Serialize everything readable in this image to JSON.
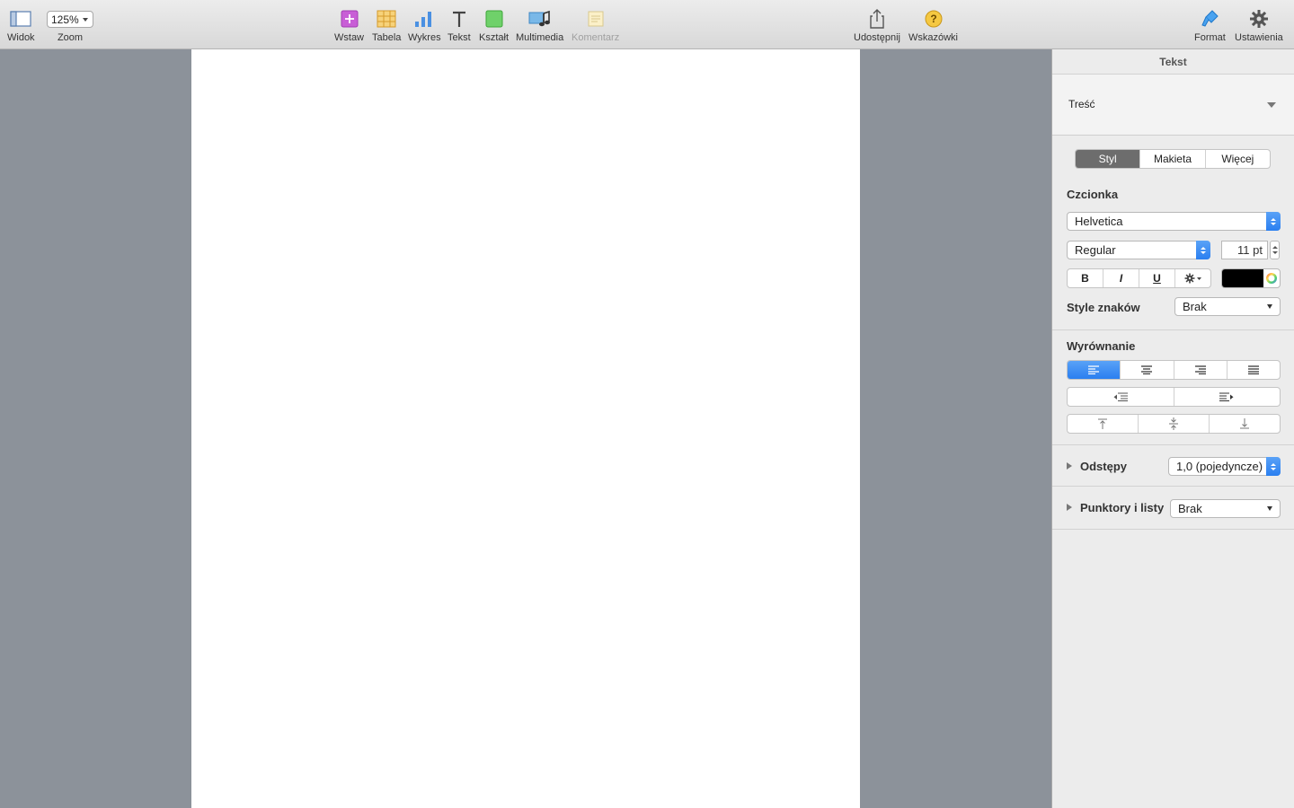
{
  "toolbar": {
    "view_label": "Widok",
    "zoom_value": "125%",
    "zoom_label": "Zoom",
    "insert_label": "Wstaw",
    "table_label": "Tabela",
    "chart_label": "Wykres",
    "text_label": "Tekst",
    "shape_label": "Kształt",
    "media_label": "Multimedia",
    "comment_label": "Komentarz",
    "share_label": "Udostępnij",
    "tips_label": "Wskazówki",
    "format_label": "Format",
    "setup_label": "Ustawienia"
  },
  "inspector": {
    "title": "Tekst",
    "paragraph_style": "Treść",
    "tabs": {
      "style": "Styl",
      "layout": "Makieta",
      "more": "Więcej"
    },
    "font_heading": "Czcionka",
    "font_family": "Helvetica",
    "font_typeface": "Regular",
    "font_size": "11 pt",
    "bold": "B",
    "italic": "I",
    "underline": "U",
    "char_styles_label": "Style znaków",
    "char_styles_value": "Brak",
    "alignment_heading": "Wyrównanie",
    "spacing_label": "Odstępy",
    "spacing_value": "1,0 (pojedyncze)",
    "bullets_label": "Punktory i listy",
    "bullets_value": "Brak"
  },
  "colors": {
    "accent": "#2a7ff0",
    "text_color": "#000000"
  }
}
